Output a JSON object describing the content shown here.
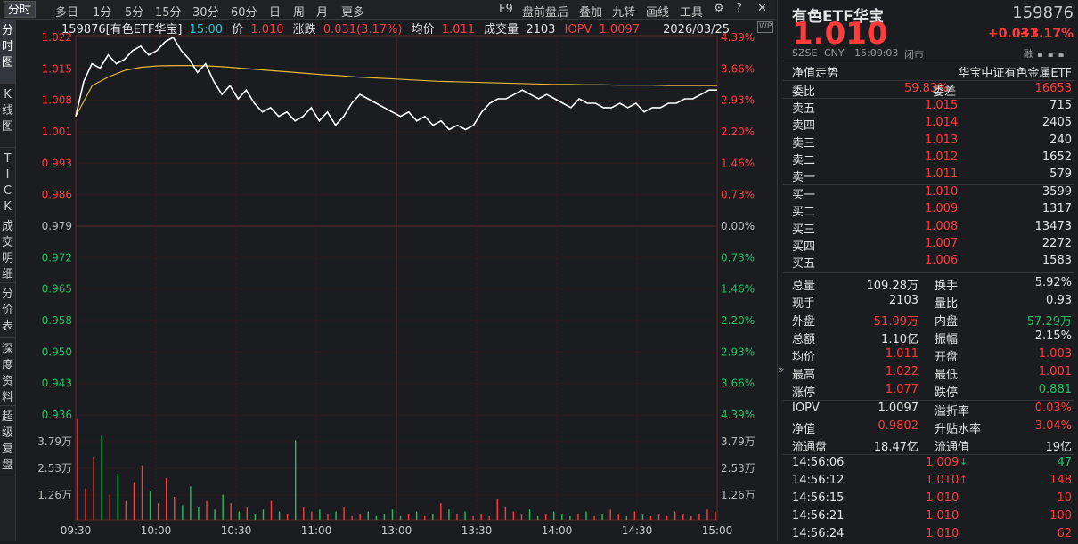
{
  "toolbar": {
    "periods": [
      "分时",
      "多日",
      "1分",
      "5分",
      "15分",
      "30分",
      "60分",
      "日",
      "周",
      "月",
      "更多"
    ],
    "tools": [
      "F9",
      "盘前盘后",
      "叠加",
      "九转",
      "画线",
      "工具"
    ]
  },
  "leftnav": [
    "分时图",
    "K线图",
    "TICK",
    "成交明细",
    "分价表",
    "深度资料",
    "超级复盘"
  ],
  "info": {
    "code_name": "159876[有色ETF华宝]",
    "time": "15:00",
    "price_label": "价",
    "price": "1.010",
    "change_label": "涨跌",
    "change": "0.031(3.17%)",
    "avg_label": "均价",
    "avg": "1.011",
    "vol_label": "成交量",
    "vol": "2103",
    "iopv_label": "IOPV",
    "iopv": "1.0097",
    "date": "2026/03/25",
    "wp": "WP"
  },
  "chart_data": {
    "type": "line",
    "prev_close": 0.979,
    "ylim": [
      0.936,
      1.022
    ],
    "price_ticks": [
      "1.022",
      "1.015",
      "1.008",
      "1.001",
      "0.993",
      "0.986",
      "0.979",
      "0.972",
      "0.965",
      "0.958",
      "0.950",
      "0.943",
      "0.936"
    ],
    "pct_ticks": [
      "4.39%",
      "3.66%",
      "2.93%",
      "2.20%",
      "1.46%",
      "0.73%",
      "0.00%",
      "0.73%",
      "1.46%",
      "2.20%",
      "2.93%",
      "3.66%",
      "4.39%"
    ],
    "vol_ticks": [
      "3.79万",
      "2.53万",
      "1.26万"
    ],
    "vol_max": 50000,
    "x_labels": [
      "09:30",
      "10:00",
      "10:30",
      "11:00",
      "13:00",
      "13:30",
      "14:00",
      "14:30",
      "15:00"
    ],
    "price_series": [
      1.004,
      1.012,
      1.016,
      1.015,
      1.018,
      1.016,
      1.017,
      1.019,
      1.02,
      1.018,
      1.019,
      1.021,
      1.022,
      1.019,
      1.017,
      1.014,
      1.016,
      1.012,
      1.009,
      1.011,
      1.008,
      1.01,
      1.007,
      1.005,
      1.006,
      1.004,
      1.005,
      1.003,
      1.004,
      1.006,
      1.003,
      1.005,
      1.002,
      1.004,
      1.007,
      1.009,
      1.008,
      1.007,
      1.006,
      1.005,
      1.004,
      1.005,
      1.003,
      1.004,
      1.002,
      1.003,
      1.001,
      1.002,
      1.001,
      1.002,
      1.005,
      1.007,
      1.008,
      1.008,
      1.009,
      1.01,
      1.009,
      1.008,
      1.009,
      1.008,
      1.007,
      1.006,
      1.008,
      1.007,
      1.007,
      1.006,
      1.006,
      1.007,
      1.006,
      1.007,
      1.005,
      1.006,
      1.006,
      1.007,
      1.007,
      1.008,
      1.008,
      1.009,
      1.01,
      1.01
    ],
    "avg_series": [
      1.004,
      1.011,
      1.013,
      1.0145,
      1.0152,
      1.0155,
      1.0156,
      1.0156,
      1.0155,
      1.0153,
      1.015,
      1.0147,
      1.0144,
      1.0141,
      1.0138,
      1.0135,
      1.0133,
      1.013,
      1.0128,
      1.0126,
      1.0124,
      1.0122,
      1.012,
      1.0119,
      1.0118,
      1.0117,
      1.0116,
      1.0115,
      1.0114,
      1.0113,
      1.0113,
      1.0112,
      1.0112,
      1.0111,
      1.0111,
      1.0111,
      1.011,
      1.011,
      1.011,
      1.011
    ],
    "volumes": [
      48000,
      15000,
      30000,
      40000,
      12000,
      22000,
      9000,
      18000,
      26000,
      14000,
      8000,
      20000,
      11000,
      7000,
      16000,
      6000,
      9000,
      5000,
      12000,
      8000,
      4000,
      6000,
      3000,
      5000,
      9000,
      4000,
      3000,
      38000,
      6000,
      4000,
      5000,
      3000,
      4000,
      6000,
      2000,
      3000,
      4000,
      2000,
      3000,
      5000,
      2000,
      3000,
      4000,
      2000,
      3000,
      8000,
      5000,
      3000,
      4000,
      2000,
      3000,
      2000,
      10000,
      6000,
      4000,
      3000,
      5000,
      2000,
      3000,
      4000,
      3000,
      2000,
      3000,
      4000,
      2000,
      3000,
      5000,
      3000,
      2000,
      4000,
      3000,
      2000,
      3000,
      2000,
      4000,
      3000,
      2000,
      3000,
      5000,
      4000
    ]
  },
  "side": {
    "name": "有色ETF华宝",
    "code": "159876",
    "price": "1.010",
    "chg": "+0.031",
    "pct": "+3.17%",
    "meta1": "SZSE",
    "meta2": "CNY",
    "meta3": "15:00:03",
    "meta4": "闭市",
    "nav_label": "净值走势",
    "index_name": "华宝中证有色金属ETF",
    "weibi_label": "委比",
    "weibi": "59.83%",
    "weicha_label": "委差",
    "weicha": "16653",
    "asks": [
      {
        "label": "卖五",
        "price": "1.015",
        "vol": "715"
      },
      {
        "label": "卖四",
        "price": "1.014",
        "vol": "2405"
      },
      {
        "label": "卖三",
        "price": "1.013",
        "vol": "240"
      },
      {
        "label": "卖二",
        "price": "1.012",
        "vol": "1652"
      },
      {
        "label": "卖一",
        "price": "1.011",
        "vol": "579"
      }
    ],
    "bids": [
      {
        "label": "买一",
        "price": "1.010",
        "vol": "3599"
      },
      {
        "label": "买二",
        "price": "1.009",
        "vol": "1317"
      },
      {
        "label": "买三",
        "price": "1.008",
        "vol": "13473"
      },
      {
        "label": "买四",
        "price": "1.007",
        "vol": "2272"
      },
      {
        "label": "买五",
        "price": "1.006",
        "vol": "1583"
      }
    ],
    "stats": [
      {
        "l1": "总量",
        "v1": "109.28万",
        "c1": "w",
        "l2": "换手",
        "v2": "5.92%",
        "c2": "w"
      },
      {
        "l1": "现手",
        "v1": "2103",
        "c1": "w",
        "l2": "量比",
        "v2": "0.93",
        "c2": "w"
      },
      {
        "l1": "外盘",
        "v1": "51.99万",
        "c1": "r",
        "l2": "内盘",
        "v2": "57.29万",
        "c2": "g"
      },
      {
        "l1": "总额",
        "v1": "1.10亿",
        "c1": "w",
        "l2": "振幅",
        "v2": "2.15%",
        "c2": "w"
      },
      {
        "l1": "均价",
        "v1": "1.011",
        "c1": "r",
        "l2": "开盘",
        "v2": "1.003",
        "c2": "r"
      },
      {
        "l1": "最高",
        "v1": "1.022",
        "c1": "r",
        "l2": "最低",
        "v2": "1.001",
        "c2": "r"
      },
      {
        "l1": "涨停",
        "v1": "1.077",
        "c1": "r",
        "l2": "跌停",
        "v2": "0.881",
        "c2": "g"
      }
    ],
    "stats2": [
      {
        "l1": "IOPV",
        "v1": "1.0097",
        "c1": "w",
        "l2": "溢折率",
        "v2": "0.03%",
        "c2": "r"
      },
      {
        "l1": "净值",
        "v1": "0.9802",
        "c1": "r",
        "l2": "升贴水率",
        "v2": "3.04%",
        "c2": "r"
      },
      {
        "l1": "流通盘",
        "v1": "18.47亿",
        "c1": "w",
        "l2": "流通值",
        "v2": "19亿",
        "c2": "w"
      }
    ],
    "ticks": [
      {
        "time": "14:56:06",
        "price": "1.009",
        "dir": "down",
        "vol": "47",
        "vc": "g"
      },
      {
        "time": "14:56:12",
        "price": "1.010",
        "dir": "up",
        "vol": "148",
        "vc": "r"
      },
      {
        "time": "14:56:15",
        "price": "1.010",
        "dir": "",
        "vol": "10",
        "vc": "r"
      },
      {
        "time": "14:56:21",
        "price": "1.010",
        "dir": "",
        "vol": "100",
        "vc": "r"
      },
      {
        "time": "14:56:24",
        "price": "1.010",
        "dir": "",
        "vol": "62",
        "vc": "r"
      }
    ],
    "rong": "融"
  },
  "colors": {
    "up": "#ff3b3b",
    "down": "#20c060",
    "avg": "#e5b93c",
    "price_line": "#ffffff",
    "grid": "#3a1414"
  }
}
